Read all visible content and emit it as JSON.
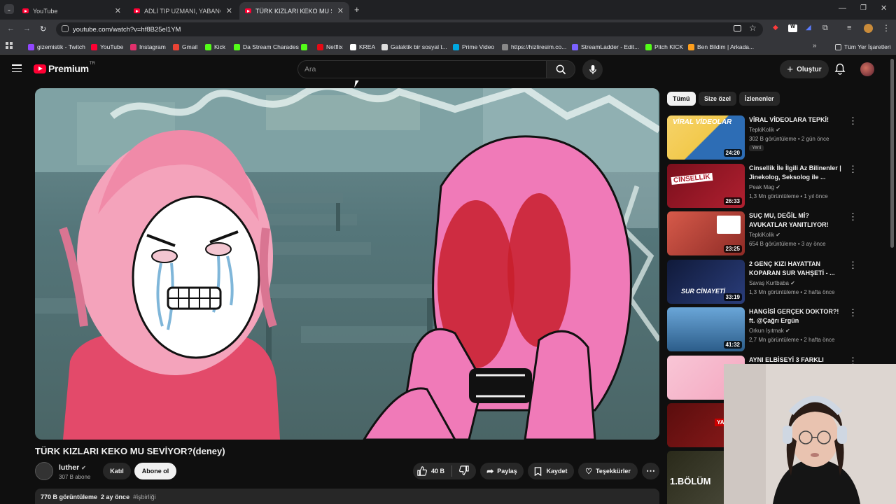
{
  "browser": {
    "tabs": [
      {
        "label": "YouTube",
        "active": false
      },
      {
        "label": "ADLİ TIP UZMANI, YABANCI DE",
        "active": false
      },
      {
        "label": "TÜRK KIZLARI KEKO MU SEVİYO",
        "active": true
      }
    ],
    "new_tab": "+",
    "url": "youtube.com/watch?v=hf8B25el1YM",
    "bookmarks": [
      {
        "label": "gizemistik - Twitch",
        "color": "#9146ff"
      },
      {
        "label": "YouTube",
        "color": "#ff0033"
      },
      {
        "label": "Instagram",
        "color": "#e1306c"
      },
      {
        "label": "Gmail",
        "color": "#ea4335"
      },
      {
        "label": "Kick",
        "color": "#53fc18"
      },
      {
        "label": "Da Stream Charades",
        "color": "#53fc18"
      },
      {
        "label": "",
        "color": "#53fc18"
      },
      {
        "label": "Netflix",
        "color": "#e50914"
      },
      {
        "label": "KREA",
        "color": "#ffffff"
      },
      {
        "label": "Galaktik bir sosyal t...",
        "color": "#dddddd"
      },
      {
        "label": "Prime Video",
        "color": "#00a8e1"
      },
      {
        "label": "https://hizliresim.co...",
        "color": "#888888"
      },
      {
        "label": "StreamLadder - Edit...",
        "color": "#7b61ff"
      },
      {
        "label": "Pitch KICK",
        "color": "#53fc18"
      },
      {
        "label": "Ben Bildim | Arkada...",
        "color": "#ff9f1c"
      }
    ],
    "all_bookmarks": "Tüm Yer İşaretleri"
  },
  "youtube": {
    "logo_word": "Premium",
    "logo_region": "TR",
    "search_placeholder": "Ara",
    "create_label": "Oluştur"
  },
  "video": {
    "title": "TÜRK KIZLARI KEKO MU SEVİYOR?(deney)",
    "channel_name": "luther",
    "subscribers": "307 B abone",
    "join_label": "Katıl",
    "subscribe_label": "Abone ol",
    "likes": "40 B",
    "share_label": "Paylaş",
    "save_label": "Kaydet",
    "thanks_label": "Teşekkürler",
    "views": "770 B görüntüleme",
    "date": "2 ay önce",
    "hashtag": "#işbirliği"
  },
  "sidebar": {
    "chips": [
      "Tümü",
      "Size özel",
      "İzlenenler"
    ],
    "items": [
      {
        "title": "VİRAL VİDEOLARA TEPKİ!",
        "channel": "TepkiKolik",
        "meta": "302 B görüntüleme • 2 gün önce",
        "duration": "24:20",
        "badge": "Yeni",
        "thumb": "#f2c94c"
      },
      {
        "title": "Cinsellik İle İlgili Az Bilinenler | Jinekolog, Seksolog ile ...",
        "channel": "Peak Mag",
        "meta": "1,3 Mn görüntüleme • 1 yıl önce",
        "duration": "26:33",
        "badge": "",
        "thumb": "#b02030"
      },
      {
        "title": "SUÇ MU, DEĞİL Mİ? AVUKATLAR YANITLIYOR!",
        "channel": "TepkiKolik",
        "meta": "654 B görüntüleme • 3 ay önce",
        "duration": "23:25",
        "badge": "",
        "thumb": "#c0392b"
      },
      {
        "title": "2 GENÇ KIZI HAYATTAN KOPARAN SUR VAHŞETİ - ...",
        "channel": "Savaş Kurtbaba",
        "meta": "1,3 Mn görüntüleme • 2 hafta önce",
        "duration": "33:19",
        "badge": "",
        "thumb": "#1e2a5a"
      },
      {
        "title": "HANGİSİ GERÇEK DOKTOR?! ft. @Çağrı Ergün",
        "channel": "Orkun Işıtmak",
        "meta": "2,7 Mn görüntüleme • 2 hafta önce",
        "duration": "41:32",
        "badge": "",
        "thumb": "#2c5d8a"
      },
      {
        "title": "AYNI ELBİSEYİ 3 FARKLI",
        "channel": "",
        "meta": "",
        "duration": "",
        "badge": "",
        "thumb": "#f4a7c0"
      },
      {
        "title": "",
        "channel": "",
        "meta": "",
        "duration": "",
        "badge": "",
        "thumb": "#8b1a1a"
      },
      {
        "title": "",
        "channel": "",
        "meta": "",
        "duration": "",
        "badge": "",
        "thumb": "#3a3a2a"
      }
    ],
    "thumb_texts": {
      "viral": "VİRAL VİDEOLAR",
      "cinsellik": "CİNSELLİK",
      "sur": "SUR CİNAYETİ",
      "yalan": "YALAN",
      "bolum": "1.BÖLÜM"
    }
  }
}
